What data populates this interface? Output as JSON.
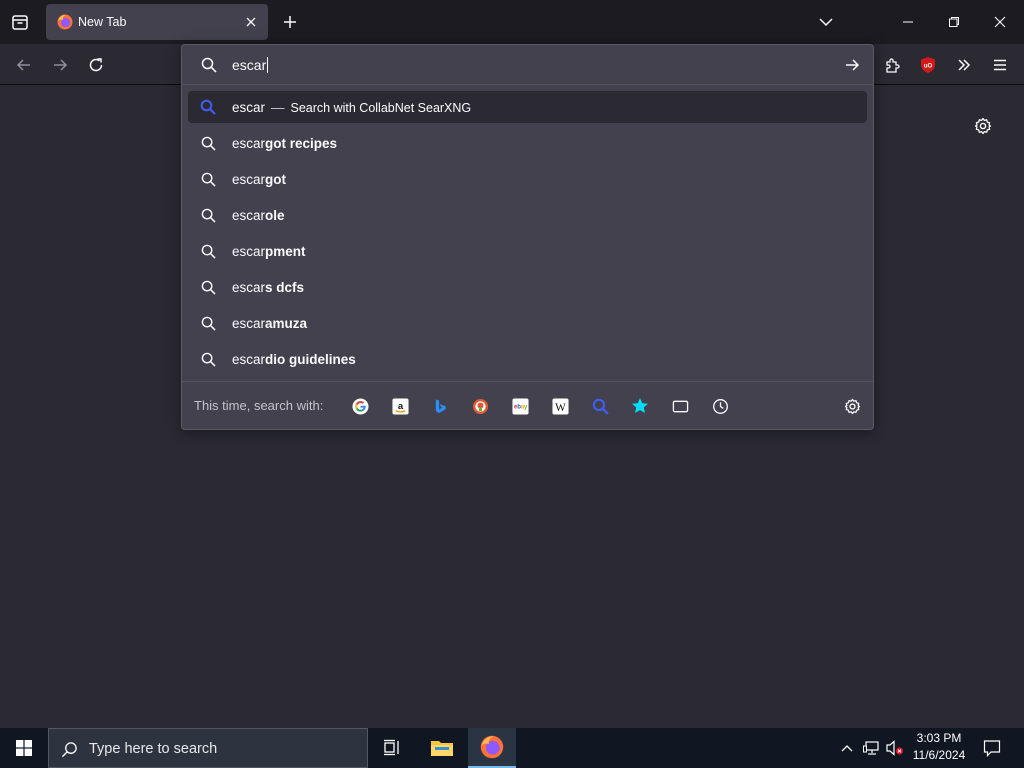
{
  "tab": {
    "title": "New Tab"
  },
  "urlbar": {
    "query": "escar",
    "first_result": {
      "text": "escar",
      "separator": "—",
      "action": "Search with CollabNet SearXNG"
    },
    "suggestions": [
      {
        "typed": "escar",
        "completion": "got recipes"
      },
      {
        "typed": "escar",
        "completion": "got"
      },
      {
        "typed": "escar",
        "completion": "ole"
      },
      {
        "typed": "escar",
        "completion": "pment"
      },
      {
        "typed": "escar",
        "completion": "s dcfs"
      },
      {
        "typed": "escar",
        "completion": "amuza"
      },
      {
        "typed": "escar",
        "completion": "dio guidelines"
      }
    ],
    "one_off_label": "This time, search with:",
    "engines": [
      "google-icon",
      "amazon-icon",
      "bing-icon",
      "duckduckgo-icon",
      "ebay-icon",
      "wikipedia-icon",
      "searxng-icon",
      "bookmarks-icon",
      "tabs-icon",
      "history-icon"
    ]
  },
  "taskbar": {
    "search_placeholder": "Type here to search",
    "time": "3:03 PM",
    "date": "11/6/2024"
  },
  "colors": {
    "accent": "#76b9ed",
    "selected_search_icon": "#3f5ef0",
    "ublock": "#d31a1a"
  }
}
